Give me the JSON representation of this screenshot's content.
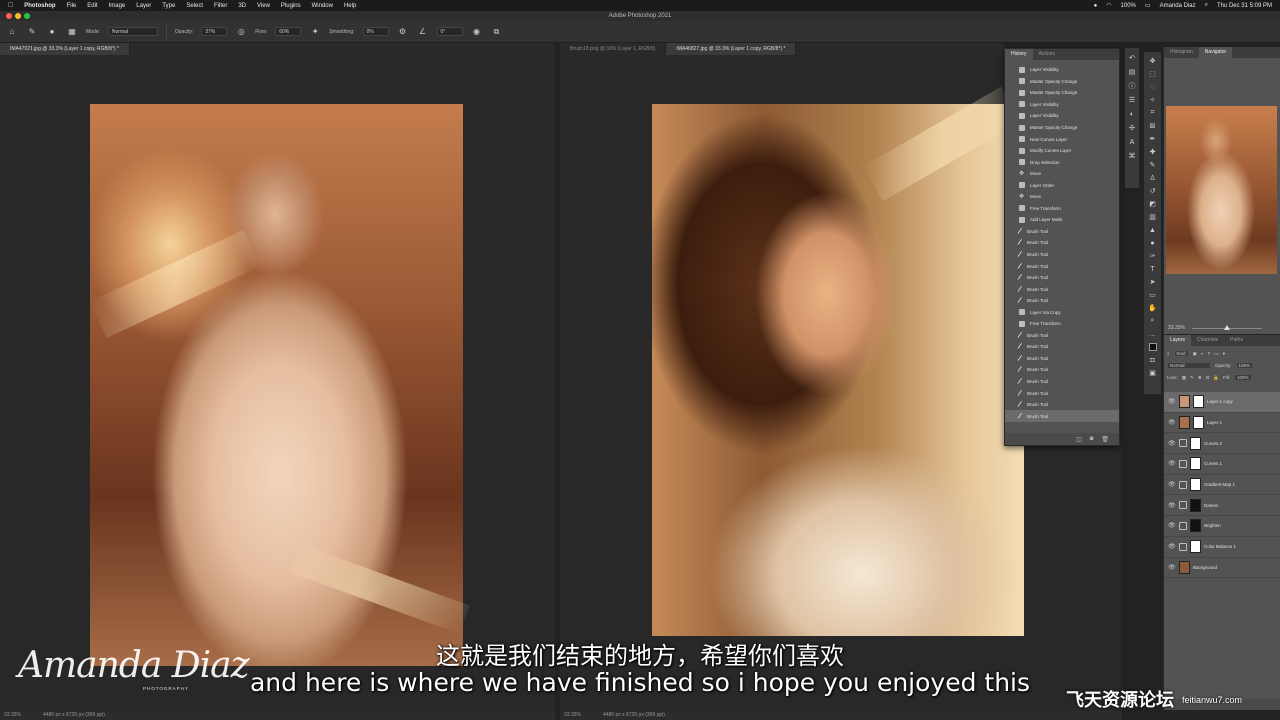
{
  "menubar": {
    "app": "Photoshop",
    "items": [
      "File",
      "Edit",
      "Image",
      "Layer",
      "Type",
      "Select",
      "Filter",
      "3D",
      "View",
      "Plugins",
      "Window",
      "Help"
    ],
    "battery": "100%",
    "user": "Amanda Diaz",
    "clock": "Thu Dec 31  5:09 PM"
  },
  "window": {
    "title": "Adobe Photoshop 2021"
  },
  "options_bar": {
    "mode_label": "Mode:",
    "mode_value": "Normal",
    "opacity_label": "Opacity:",
    "opacity_value": "37%",
    "flow_label": "Flow:",
    "flow_value": "60%",
    "smoothing_label": "Smoothing:",
    "smoothing_value": "0%",
    "angle_value": "0°"
  },
  "documents": {
    "left_tab": "IMA47021.jpg @ 33.3% (Layer 1 copy, RGB/8*) *",
    "right_tab_1": "Brush18.png @ 33% (Layer 1, RGB/8)",
    "right_tab_2": "IMA46827.jpg @ 33.3% (Layer 1 copy, RGB/8*) *",
    "left_zoom": "33.33%",
    "left_dims": "4480 px x 6720 px (300 ppi)",
    "right_zoom": "33.33%",
    "right_dims": "4480 px x 6720 px (300 ppi)"
  },
  "history": {
    "tabs": [
      "History",
      "Actions"
    ],
    "items": [
      {
        "label": "Layer Visibility",
        "icon": "doc-icon"
      },
      {
        "label": "Master Opacity Change",
        "icon": "doc-icon"
      },
      {
        "label": "Master Opacity Change",
        "icon": "doc-icon"
      },
      {
        "label": "Layer Visibility",
        "icon": "doc-icon"
      },
      {
        "label": "Layer Visibility",
        "icon": "doc-icon"
      },
      {
        "label": "Master Opacity Change",
        "icon": "doc-icon"
      },
      {
        "label": "New Curves Layer",
        "icon": "doc-icon"
      },
      {
        "label": "Modify Curves Layer",
        "icon": "doc-icon"
      },
      {
        "label": "Drop Selection",
        "icon": "doc-icon"
      },
      {
        "label": "Move",
        "icon": "move-icon"
      },
      {
        "label": "Layer Order",
        "icon": "doc-icon"
      },
      {
        "label": "Move",
        "icon": "move-icon"
      },
      {
        "label": "Free Transform",
        "icon": "doc-icon"
      },
      {
        "label": "Add Layer Mask",
        "icon": "doc-icon"
      },
      {
        "label": "Brush Tool",
        "icon": "brush-icon"
      },
      {
        "label": "Brush Tool",
        "icon": "brush-icon"
      },
      {
        "label": "Brush Tool",
        "icon": "brush-icon"
      },
      {
        "label": "Brush Tool",
        "icon": "brush-icon"
      },
      {
        "label": "Brush Tool",
        "icon": "brush-icon"
      },
      {
        "label": "Brush Tool",
        "icon": "brush-icon"
      },
      {
        "label": "Brush Tool",
        "icon": "brush-icon"
      },
      {
        "label": "Layer Via Copy",
        "icon": "doc-icon"
      },
      {
        "label": "Free Transform",
        "icon": "doc-icon"
      },
      {
        "label": "Brush Tool",
        "icon": "brush-icon"
      },
      {
        "label": "Brush Tool",
        "icon": "brush-icon"
      },
      {
        "label": "Brush Tool",
        "icon": "brush-icon"
      },
      {
        "label": "Brush Tool",
        "icon": "brush-icon"
      },
      {
        "label": "Brush Tool",
        "icon": "brush-icon"
      },
      {
        "label": "Brush Tool",
        "icon": "brush-icon"
      },
      {
        "label": "Brush Tool",
        "icon": "brush-icon"
      },
      {
        "label": "Brush Tool",
        "icon": "brush-icon",
        "selected": true
      }
    ]
  },
  "navigator": {
    "tabs": [
      "Histogram",
      "Navigator"
    ],
    "zoom": "33.33%"
  },
  "layers_panel": {
    "tabs": [
      "Layers",
      "Channels",
      "Paths"
    ],
    "filter": "Kind",
    "blend_mode": "Normal",
    "opacity_label": "Opacity:",
    "opacity_value": "100%",
    "lock_label": "Lock:",
    "fill_label": "Fill:",
    "fill_value": "100%",
    "layers": [
      {
        "name": "Layer 1 copy",
        "kind": "pixel",
        "selected": true
      },
      {
        "name": "Layer 1",
        "kind": "pixel"
      },
      {
        "name": "Curves 2",
        "kind": "adjustment"
      },
      {
        "name": "Curves 1",
        "kind": "adjustment"
      },
      {
        "name": "Gradient Map 1",
        "kind": "adjustment"
      },
      {
        "name": "Darken",
        "kind": "adjustment"
      },
      {
        "name": "Brighten",
        "kind": "adjustment"
      },
      {
        "name": "Color Balance 1",
        "kind": "adjustment"
      },
      {
        "name": "Background",
        "kind": "background"
      }
    ]
  },
  "subtitles": {
    "chinese": "这就是我们结束的地方，希望你们喜欢",
    "english": "and here is where we have finished so i hope you enjoyed this"
  },
  "logos": {
    "signature": "Amanda Diaz",
    "signature_sub": "PHOTOGRAPHY",
    "watermark": "飞天资源论坛",
    "watermark_url": "feitianwu7.com"
  },
  "colors": {
    "menubar_bg": "#1b1b1b",
    "panel_bg": "#535353",
    "workspace_bg": "#282828",
    "close_red": "#ff5f57",
    "minimize_yellow": "#febc2e",
    "zoom_green": "#28c840"
  }
}
